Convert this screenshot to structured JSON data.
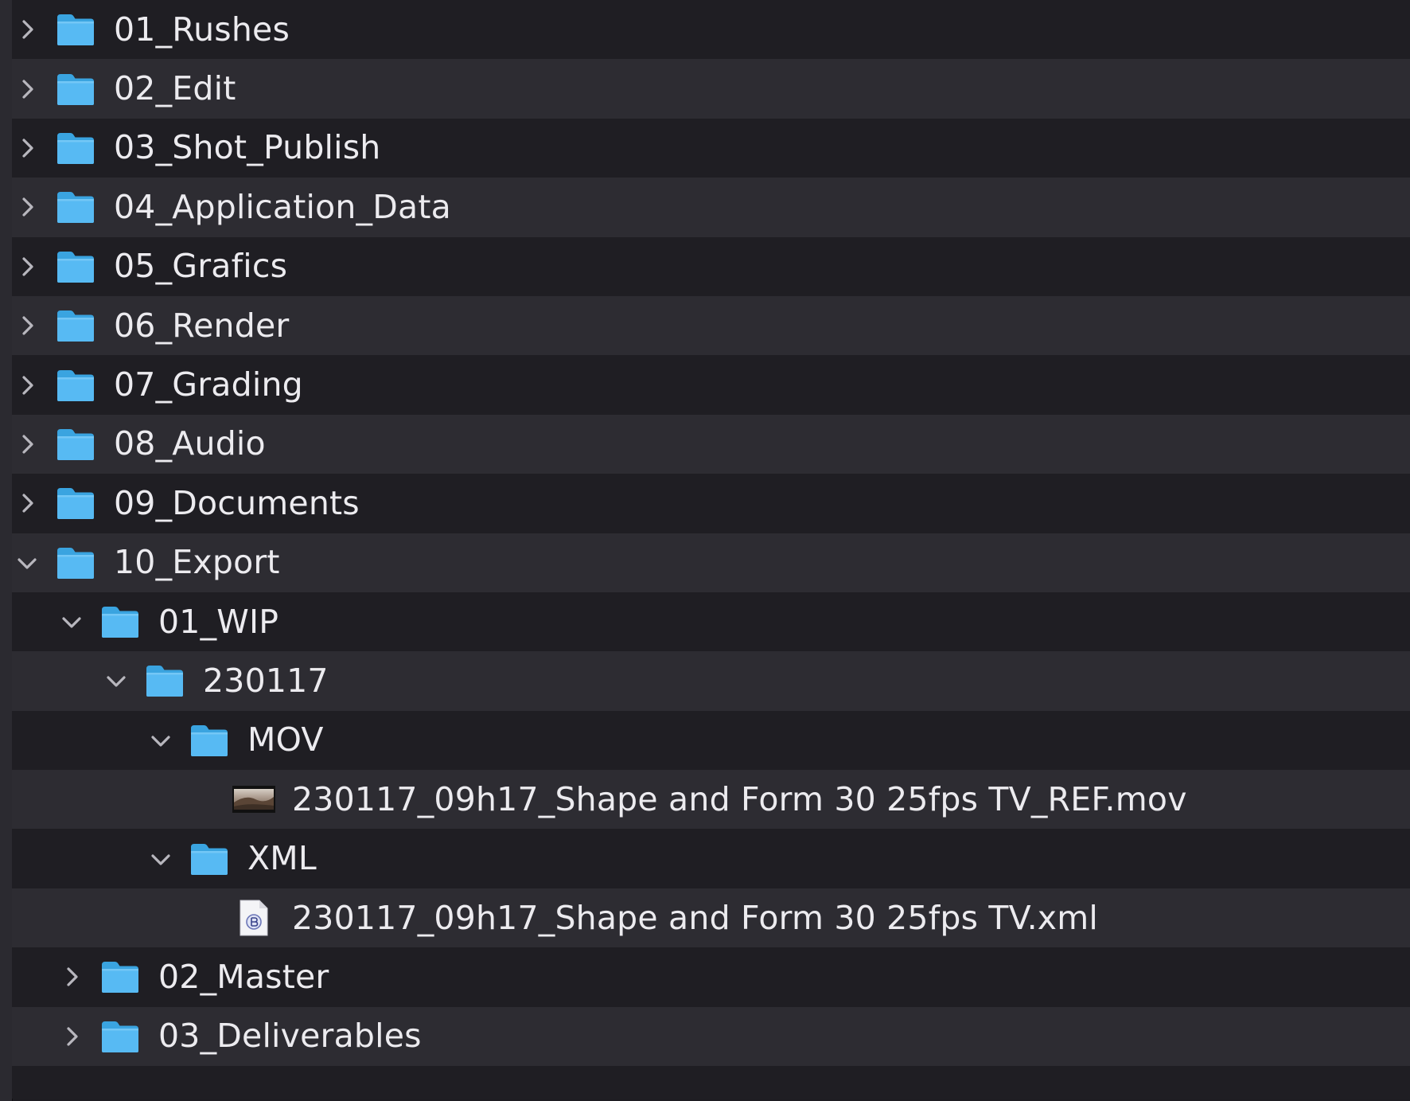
{
  "colors": {
    "row_dark": "#1f1e23",
    "row_light": "#2d2c32",
    "folder_blue": "#4cb6f2",
    "text": "#ecebef",
    "chevron": "#b8b7be"
  },
  "tree": {
    "rows": [
      {
        "label": "01_Rushes",
        "level": 0,
        "kind": "folder",
        "state": "collapsed"
      },
      {
        "label": "02_Edit",
        "level": 0,
        "kind": "folder",
        "state": "collapsed"
      },
      {
        "label": "03_Shot_Publish",
        "level": 0,
        "kind": "folder",
        "state": "collapsed"
      },
      {
        "label": "04_Application_Data",
        "level": 0,
        "kind": "folder",
        "state": "collapsed"
      },
      {
        "label": "05_Grafics",
        "level": 0,
        "kind": "folder",
        "state": "collapsed"
      },
      {
        "label": "06_Render",
        "level": 0,
        "kind": "folder",
        "state": "collapsed"
      },
      {
        "label": "07_Grading",
        "level": 0,
        "kind": "folder",
        "state": "collapsed"
      },
      {
        "label": "08_Audio",
        "level": 0,
        "kind": "folder",
        "state": "collapsed"
      },
      {
        "label": "09_Documents",
        "level": 0,
        "kind": "folder",
        "state": "collapsed"
      },
      {
        "label": "10_Export",
        "level": 0,
        "kind": "folder",
        "state": "expanded"
      },
      {
        "label": "01_WIP",
        "level": 1,
        "kind": "folder",
        "state": "expanded"
      },
      {
        "label": "230117",
        "level": 2,
        "kind": "folder",
        "state": "expanded"
      },
      {
        "label": "MOV",
        "level": 3,
        "kind": "folder",
        "state": "expanded"
      },
      {
        "label": "230117_09h17_Shape and Form 30 25fps TV_REF.mov",
        "level": 4,
        "kind": "movie-file",
        "state": "none"
      },
      {
        "label": "XML",
        "level": 3,
        "kind": "folder",
        "state": "expanded"
      },
      {
        "label": "230117_09h17_Shape and Form 30 25fps TV.xml",
        "level": 4,
        "kind": "xml-file",
        "state": "none"
      },
      {
        "label": "02_Master",
        "level": 1,
        "kind": "folder",
        "state": "collapsed"
      },
      {
        "label": "03_Deliverables",
        "level": 1,
        "kind": "folder",
        "state": "collapsed"
      }
    ]
  }
}
